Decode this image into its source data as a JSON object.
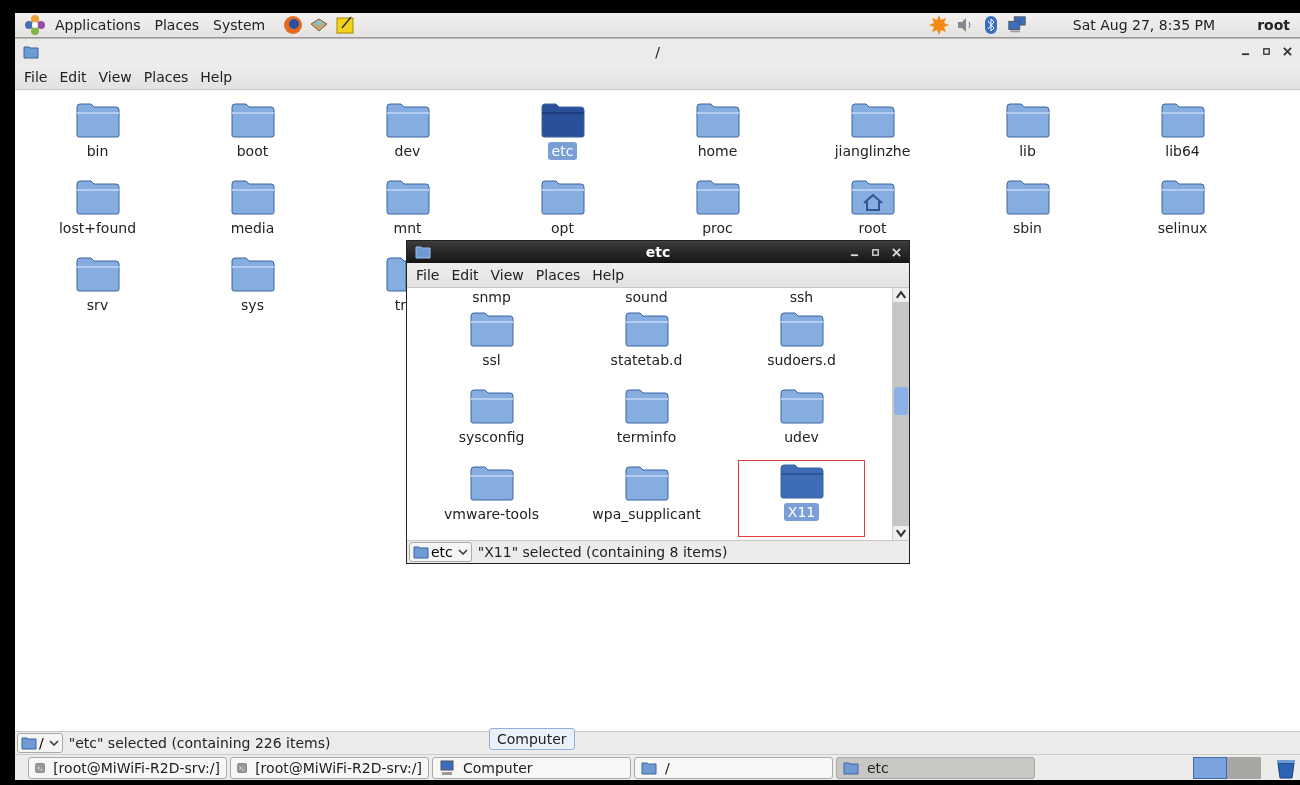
{
  "top_panel": {
    "menus": [
      "Applications",
      "Places",
      "System"
    ],
    "clock": "Sat Aug 27,  8:35 PM",
    "user": "root"
  },
  "main_window": {
    "title": "/",
    "menu": [
      "File",
      "Edit",
      "View",
      "Places",
      "Help"
    ],
    "items": [
      {
        "name": "bin",
        "kind": "folder",
        "selected": false
      },
      {
        "name": "boot",
        "kind": "folder",
        "selected": false
      },
      {
        "name": "dev",
        "kind": "folder",
        "selected": false
      },
      {
        "name": "etc",
        "kind": "folder",
        "selected": true
      },
      {
        "name": "home",
        "kind": "folder",
        "selected": false
      },
      {
        "name": "jianglinzhe",
        "kind": "folder",
        "selected": false
      },
      {
        "name": "lib",
        "kind": "folder",
        "selected": false
      },
      {
        "name": "lib64",
        "kind": "folder",
        "selected": false
      },
      {
        "name": "lost+found",
        "kind": "folder",
        "selected": false
      },
      {
        "name": "media",
        "kind": "folder",
        "selected": false
      },
      {
        "name": "mnt",
        "kind": "folder",
        "selected": false
      },
      {
        "name": "opt",
        "kind": "folder",
        "selected": false
      },
      {
        "name": "proc",
        "kind": "folder",
        "selected": false
      },
      {
        "name": "root",
        "kind": "home",
        "selected": false
      },
      {
        "name": "sbin",
        "kind": "folder",
        "selected": false
      },
      {
        "name": "selinux",
        "kind": "folder",
        "selected": false
      },
      {
        "name": "srv",
        "kind": "folder",
        "selected": false
      },
      {
        "name": "sys",
        "kind": "folder",
        "selected": false
      },
      {
        "name": "tr",
        "kind": "cut",
        "selected": false
      }
    ],
    "location": "/",
    "status": "\"etc\" selected (containing 226 items)"
  },
  "tooltip": "Computer",
  "dialog": {
    "title": "etc",
    "menu": [
      "File",
      "Edit",
      "View",
      "Places",
      "Help"
    ],
    "scrolled_labels": [
      "snmp",
      "sound",
      "ssh"
    ],
    "items": [
      {
        "name": "ssl",
        "selected": false,
        "highlighted": false
      },
      {
        "name": "statetab.d",
        "selected": false,
        "highlighted": false
      },
      {
        "name": "sudoers.d",
        "selected": false,
        "highlighted": false
      },
      {
        "name": "sysconfig",
        "selected": false,
        "highlighted": false
      },
      {
        "name": "terminfo",
        "selected": false,
        "highlighted": false
      },
      {
        "name": "udev",
        "selected": false,
        "highlighted": false
      },
      {
        "name": "vmware-tools",
        "selected": false,
        "highlighted": false
      },
      {
        "name": "wpa_supplicant",
        "selected": false,
        "highlighted": false
      },
      {
        "name": "X11",
        "selected": true,
        "highlighted": true
      }
    ],
    "location": "etc",
    "status": "\"X11\" selected (containing 8 items)"
  },
  "taskbar": [
    {
      "label": "[root@MiWiFi-R2D-srv:/]",
      "kind": "terminal",
      "selected": false
    },
    {
      "label": "[root@MiWiFi-R2D-srv:/]",
      "kind": "terminal",
      "selected": false
    },
    {
      "label": "Computer",
      "kind": "computer",
      "selected": false
    },
    {
      "label": "/",
      "kind": "folder",
      "selected": false
    },
    {
      "label": "etc",
      "kind": "folder",
      "selected": true
    }
  ],
  "workspaces": [
    {
      "selected": true
    },
    {
      "selected": false
    }
  ]
}
